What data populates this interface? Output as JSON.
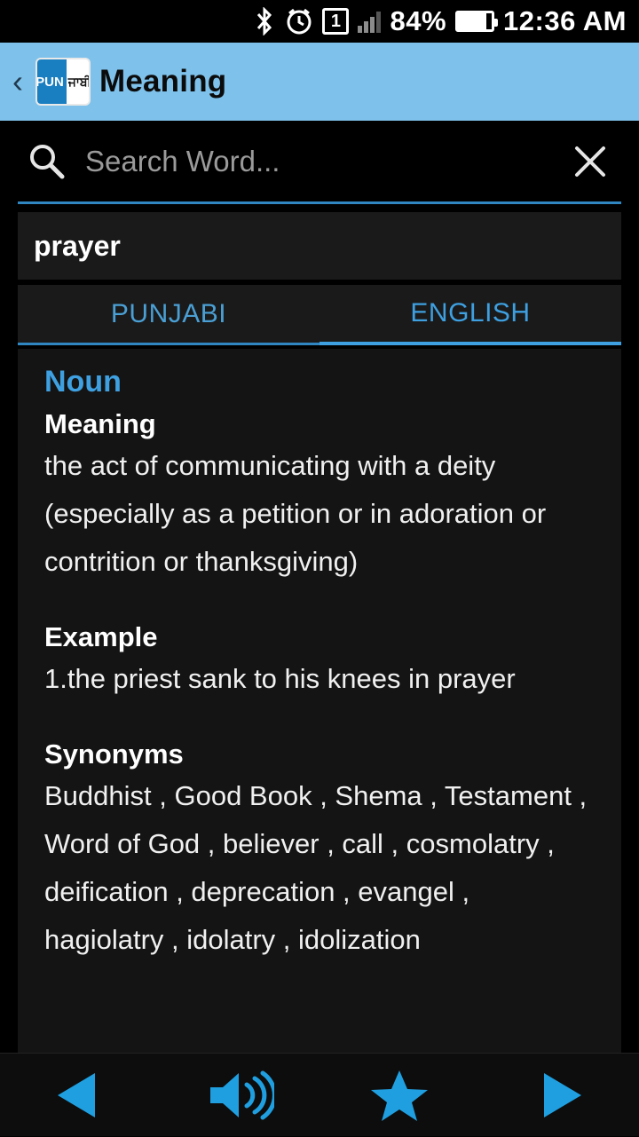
{
  "status_bar": {
    "bluetooth_icon": "bluetooth-icon",
    "alarm_icon": "alarm-icon",
    "sim_icon_label": "1",
    "signal_icon": "signal-bars-icon",
    "battery_percent": "84%",
    "battery_icon": "battery-icon",
    "clock": "12:36 AM"
  },
  "app_bar": {
    "back_label": "‹",
    "logo_left_text": "PUN",
    "logo_right_text": "ਜਾਬੀ",
    "title": "Meaning",
    "background_color": "#7ec1ea"
  },
  "search": {
    "value": "",
    "placeholder": "Search Word...",
    "search_icon": "magnifier-icon",
    "clear_icon": "close-x-icon",
    "underline_color": "#2f86c0"
  },
  "word": {
    "text": "prayer"
  },
  "tabs": [
    {
      "label": "PUNJABI",
      "active": false
    },
    {
      "label": "ENGLISH",
      "active": true
    }
  ],
  "entry": {
    "part_of_speech": "Noun",
    "meaning_heading": "Meaning",
    "meaning_text": "the act of communicating with a deity (especially as a petition or in adoration or contrition or thanksgiving)",
    "example_heading": "Example",
    "example_text": "1.the priest sank to his knees in prayer",
    "synonyms_heading": "Synonyms",
    "synonyms_text": "Buddhist , Good Book , Shema , Testament , Word of God , believer , call , cosmolatry , deification , deprecation , evangel , hagiolatry , idolatry , idolization"
  },
  "bottom_bar": {
    "previous_icon": "previous-triangle-icon",
    "speaker_icon": "speaker-volume-icon",
    "favorite_icon": "star-icon",
    "next_icon": "next-triangle-icon",
    "accent_color": "#1f9fe0"
  }
}
